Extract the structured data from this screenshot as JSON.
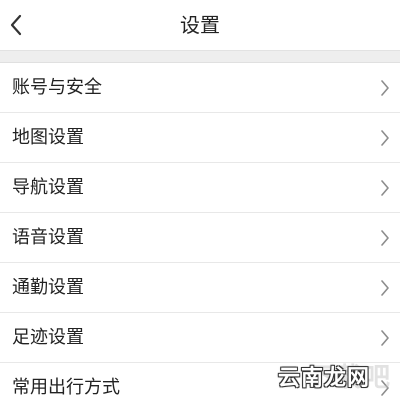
{
  "header": {
    "title": "设置",
    "back_icon": "chevron-left-icon"
  },
  "settings": {
    "items": [
      {
        "label": "账号与安全",
        "icon": "chevron-right-icon"
      },
      {
        "label": "地图设置",
        "icon": "chevron-right-icon"
      },
      {
        "label": "导航设置",
        "icon": "chevron-right-icon"
      },
      {
        "label": "语音设置",
        "icon": "chevron-right-icon"
      },
      {
        "label": "通勤设置",
        "icon": "chevron-right-icon"
      },
      {
        "label": "足迹设置",
        "icon": "chevron-right-icon"
      },
      {
        "label": "常用出行方式",
        "icon": "chevron-right-icon"
      }
    ]
  },
  "watermark": {
    "text": "云南龙网",
    "background_text": "下载吧"
  },
  "colors": {
    "background": "#f3f3f3",
    "surface": "#ffffff",
    "text": "#222222",
    "chevron": "#8c8c8c",
    "divider": "#e8e8e8"
  }
}
